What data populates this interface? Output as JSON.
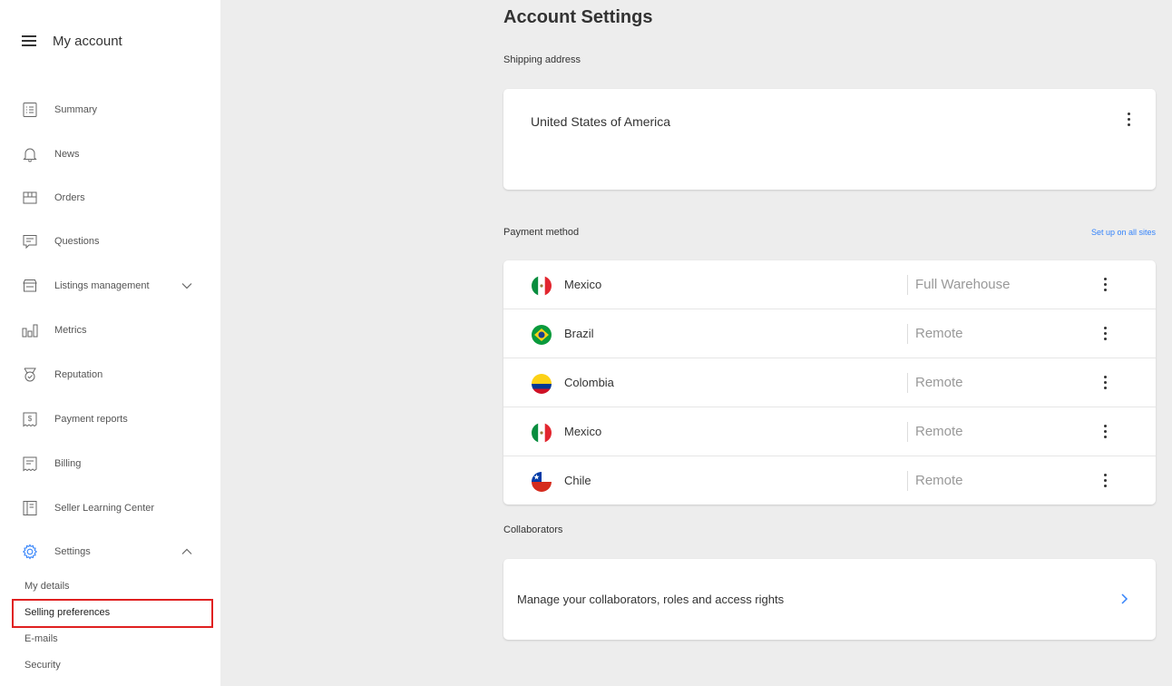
{
  "sidebar": {
    "title": "My account",
    "items": [
      {
        "label": "Summary",
        "icon": "summary-icon"
      },
      {
        "label": "News",
        "icon": "bell-icon"
      },
      {
        "label": "Orders",
        "icon": "box-icon"
      },
      {
        "label": "Questions",
        "icon": "chat-icon"
      },
      {
        "label": "Listings management",
        "icon": "store-icon"
      },
      {
        "label": "Metrics",
        "icon": "metrics-icon"
      },
      {
        "label": "Reputation",
        "icon": "medal-icon"
      },
      {
        "label": "Payment reports",
        "icon": "dollar-doc-icon"
      },
      {
        "label": "Billing",
        "icon": "receipt-icon"
      },
      {
        "label": "Seller Learning Center",
        "icon": "book-icon"
      },
      {
        "label": "Settings",
        "icon": "gear-icon"
      }
    ],
    "settings_sub": [
      {
        "label": "My details"
      },
      {
        "label": "Selling preferences"
      },
      {
        "label": "E-mails"
      },
      {
        "label": "Security"
      }
    ]
  },
  "main": {
    "title": "Account Settings",
    "shipping": {
      "label": "Shipping address",
      "value": "United States of America"
    },
    "payment": {
      "label": "Payment method",
      "link": "Set up on all sites",
      "rows": [
        {
          "country": "Mexico",
          "type": "Full Warehouse",
          "flag": "mexico"
        },
        {
          "country": "Brazil",
          "type": "Remote",
          "flag": "brazil"
        },
        {
          "country": "Colombia",
          "type": "Remote",
          "flag": "colombia"
        },
        {
          "country": "Mexico",
          "type": "Remote",
          "flag": "mexico"
        },
        {
          "country": "Chile",
          "type": "Remote",
          "flag": "chile"
        }
      ]
    },
    "collaborators": {
      "label": "Collaborators",
      "text": "Manage your collaborators, roles and access rights"
    }
  },
  "colors": {
    "link": "#3483fa",
    "highlight": "#e02020",
    "background": "#ededed"
  }
}
